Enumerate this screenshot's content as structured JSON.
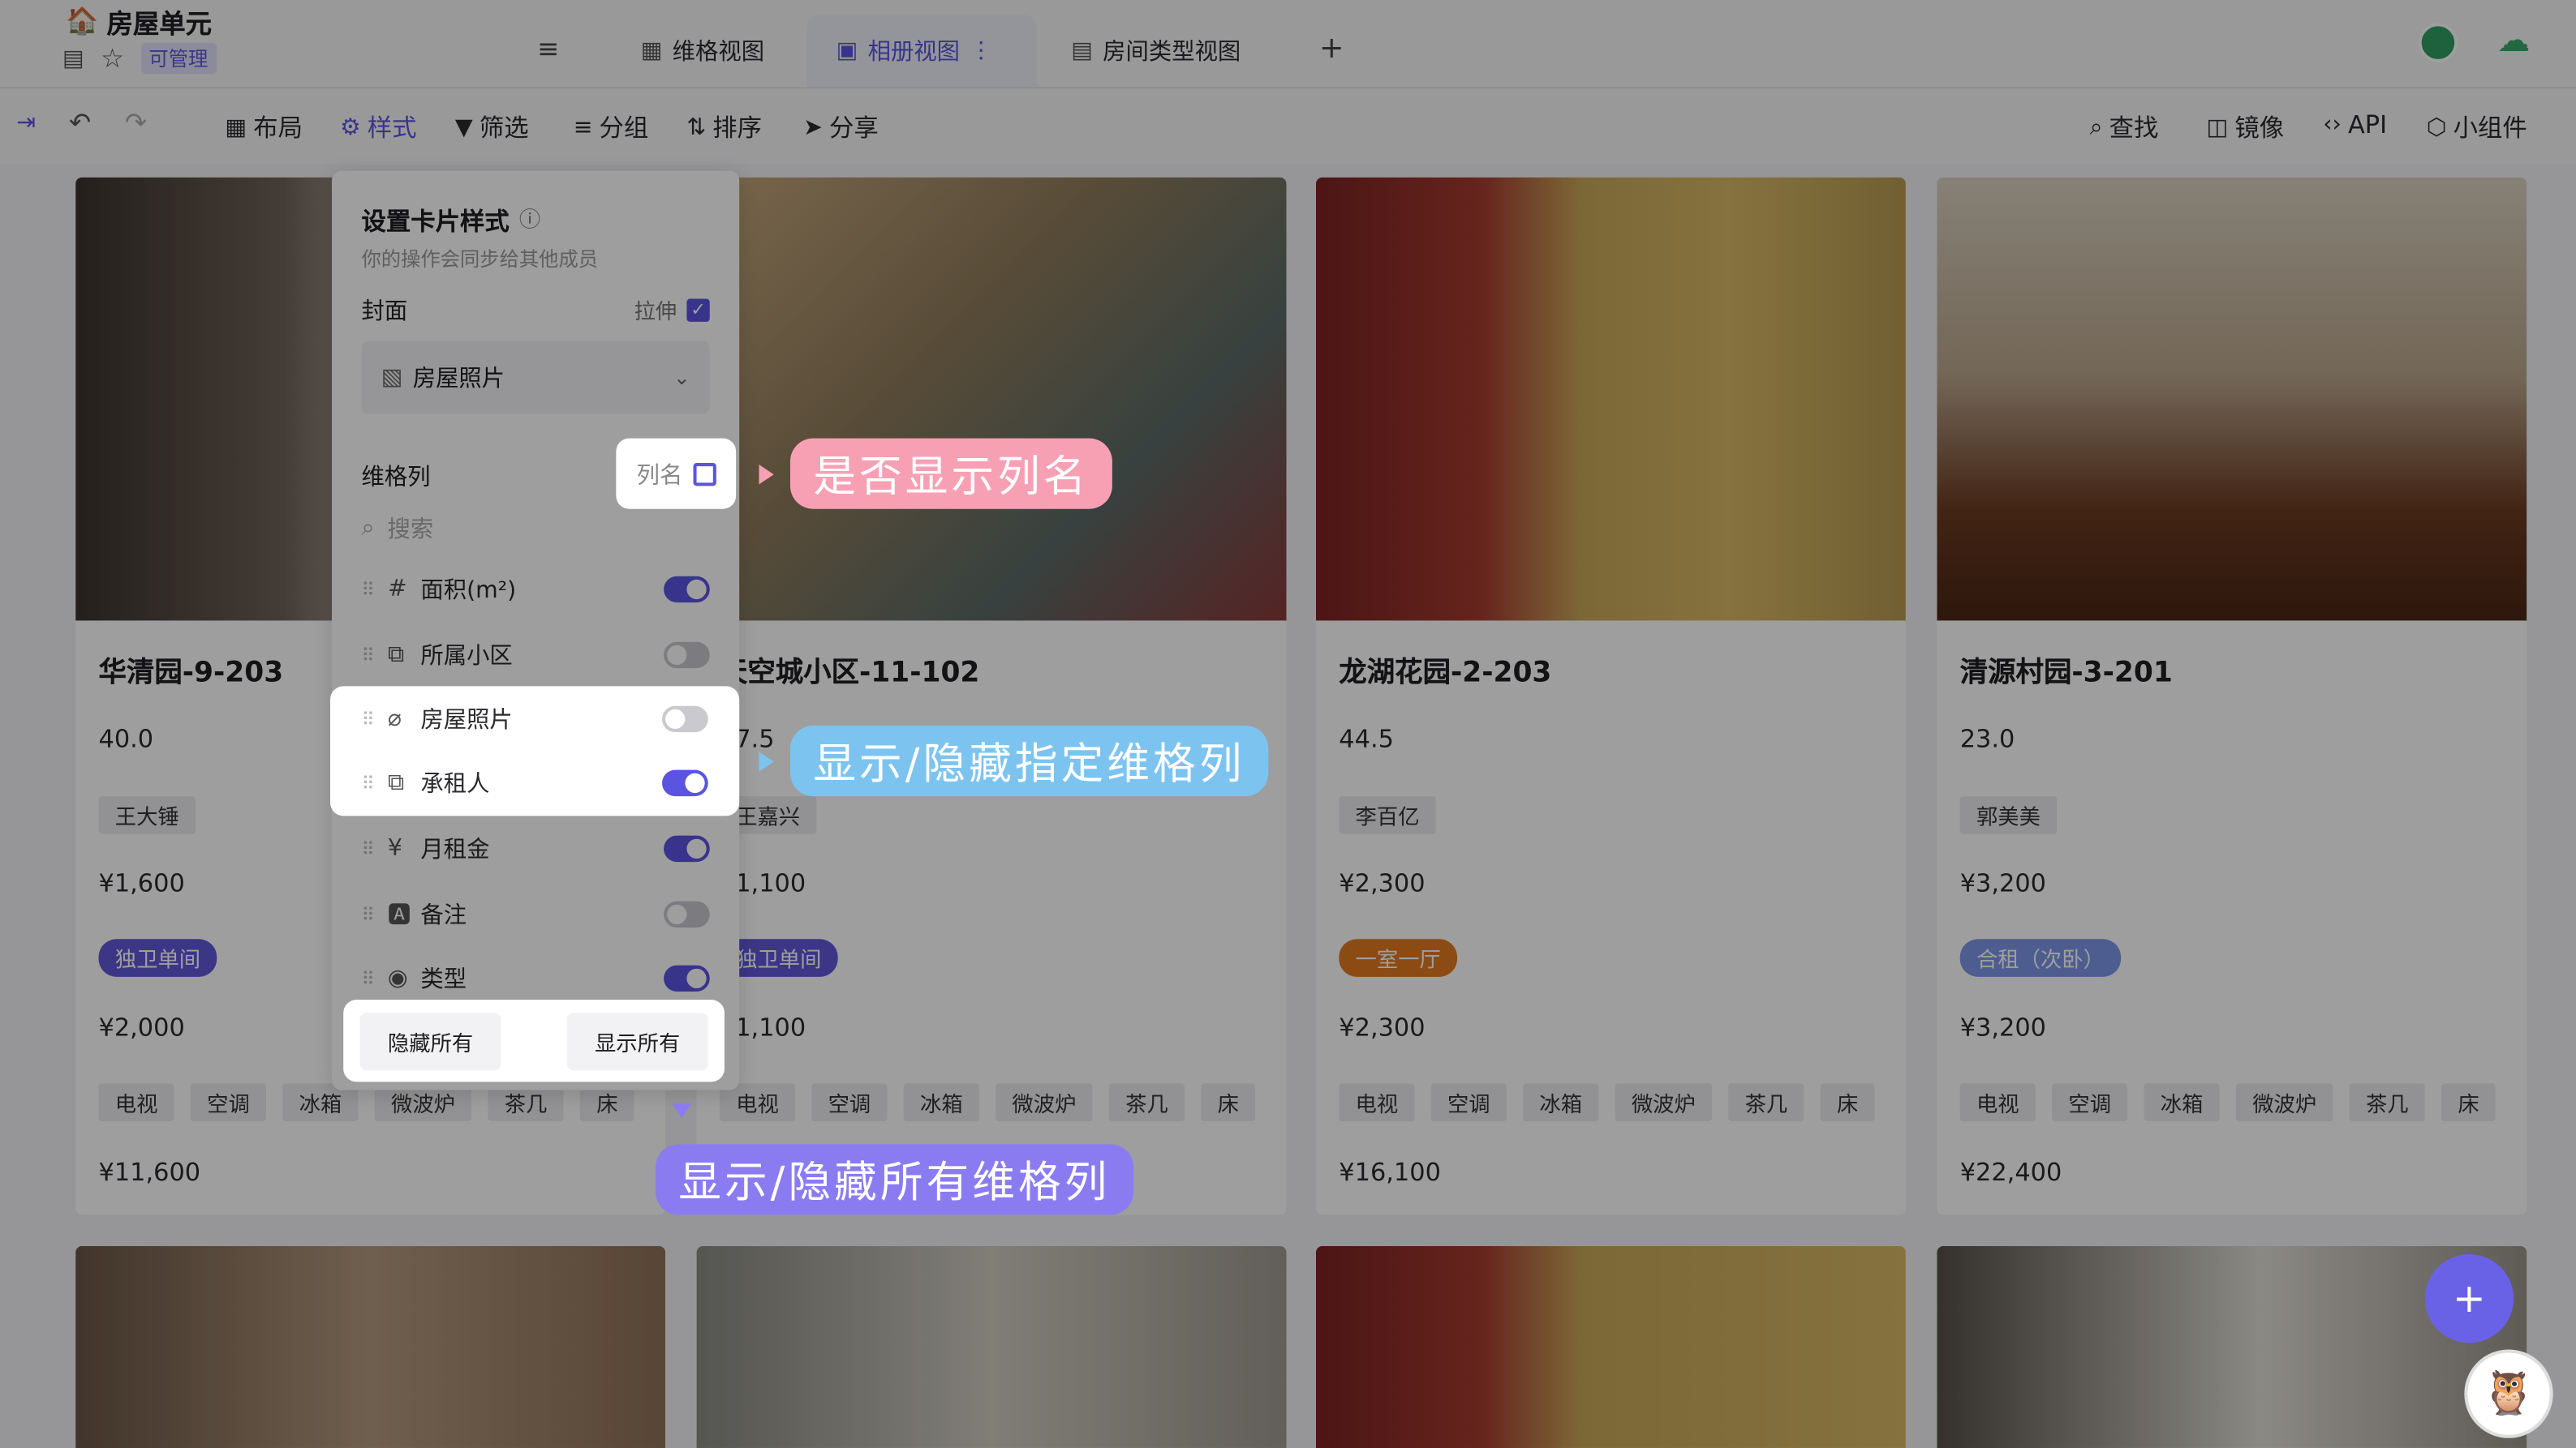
{
  "header": {
    "title": "房屋单元",
    "badge": "可管理",
    "tabs": [
      {
        "label": "维格视图"
      },
      {
        "label": "相册视图"
      },
      {
        "label": "房间类型视图"
      }
    ]
  },
  "toolbar": {
    "layout": "布局",
    "style": "样式",
    "filter": "筛选",
    "group": "分组",
    "sort": "排序",
    "share": "分享",
    "find": "查找",
    "mirror": "镜像",
    "api": "API",
    "widget": "小组件"
  },
  "panel": {
    "title": "设置卡片样式",
    "subtitle": "你的操作会同步给其他成员",
    "cover_label": "封面",
    "stretch_label": "拉伸",
    "cover_field": "房屋照片",
    "columns_label": "维格列",
    "colname_label": "列名",
    "search_placeholder": "搜索",
    "fields": [
      {
        "label": "面积(m²)",
        "on": true
      },
      {
        "label": "所属小区",
        "on": false
      },
      {
        "label": "房屋照片",
        "on": false
      },
      {
        "label": "承租人",
        "on": true
      },
      {
        "label": "月租金",
        "on": true
      },
      {
        "label": "备注",
        "on": false
      },
      {
        "label": "类型",
        "on": true
      }
    ],
    "hide_all": "隐藏所有",
    "show_all": "显示所有"
  },
  "callouts": {
    "colname": "是否显示列名",
    "specific": "显示/隐藏指定维格列",
    "all": "显示/隐藏所有维格列"
  },
  "cards": [
    {
      "title": "华清园-9-203",
      "area": "40.0",
      "tenant": "王大锤",
      "rent": "¥1,600",
      "type": "独卫单间",
      "type_color": "#6257d8",
      "price": "¥2,000",
      "amenities": [
        "电视",
        "空调",
        "冰箱",
        "微波炉",
        "茶几",
        "床"
      ],
      "total": "¥11,600"
    },
    {
      "title": "天空城小区-11-102",
      "area": "37.5",
      "tenant": "王嘉兴",
      "rent": "¥1,100",
      "type": "独卫单间",
      "type_color": "#6257d8",
      "price": "¥1,100",
      "amenities": [
        "电视",
        "空调",
        "冰箱",
        "微波炉",
        "茶几",
        "床"
      ],
      "total": ""
    },
    {
      "title": "龙湖花园-2-203",
      "area": "44.5",
      "tenant": "李百亿",
      "rent": "¥2,300",
      "type": "一室一厅",
      "type_color": "#e07a1f",
      "price": "¥2,300",
      "amenities": [
        "电视",
        "空调",
        "冰箱",
        "微波炉",
        "茶几",
        "床"
      ],
      "total": "¥16,100"
    },
    {
      "title": "清源村园-3-201",
      "area": "23.0",
      "tenant": "郭美美",
      "rent": "¥3,200",
      "type": "合租（次卧）",
      "type_color": "#7e96e8",
      "price": "¥3,200",
      "amenities": [
        "电视",
        "空调",
        "冰箱",
        "微波炉",
        "茶几",
        "床"
      ],
      "total": "¥22,400"
    }
  ],
  "fab_label": "+"
}
